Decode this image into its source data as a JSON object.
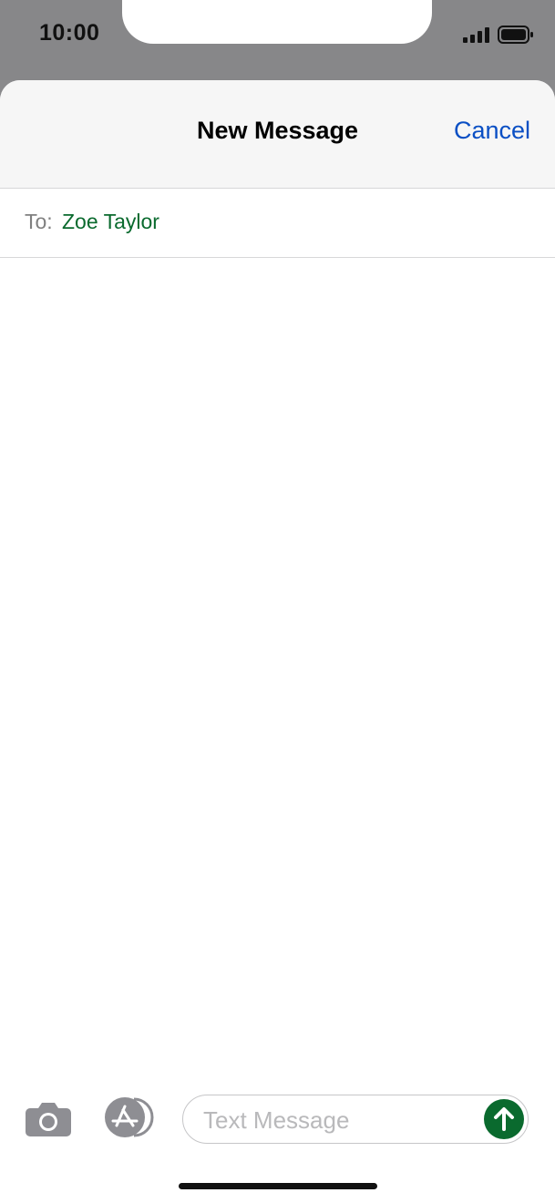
{
  "status_bar": {
    "time": "10:00",
    "signal_icon": "cellular-signal-icon",
    "battery_icon": "battery-full-icon"
  },
  "nav": {
    "title": "New Message",
    "cancel_label": "Cancel"
  },
  "recipient_row": {
    "label": "To:",
    "recipient": "Zoe Taylor"
  },
  "compose": {
    "camera_icon": "camera-icon",
    "apps_icon": "app-store-icon",
    "placeholder": "Text Message",
    "value": "",
    "send_icon": "arrow-up-icon"
  },
  "colors": {
    "accent_blue": "#0a4fc4",
    "recipient_green": "#0a6a2e",
    "send_green": "#0a6a2e",
    "status_bar_gray": "#878789"
  }
}
